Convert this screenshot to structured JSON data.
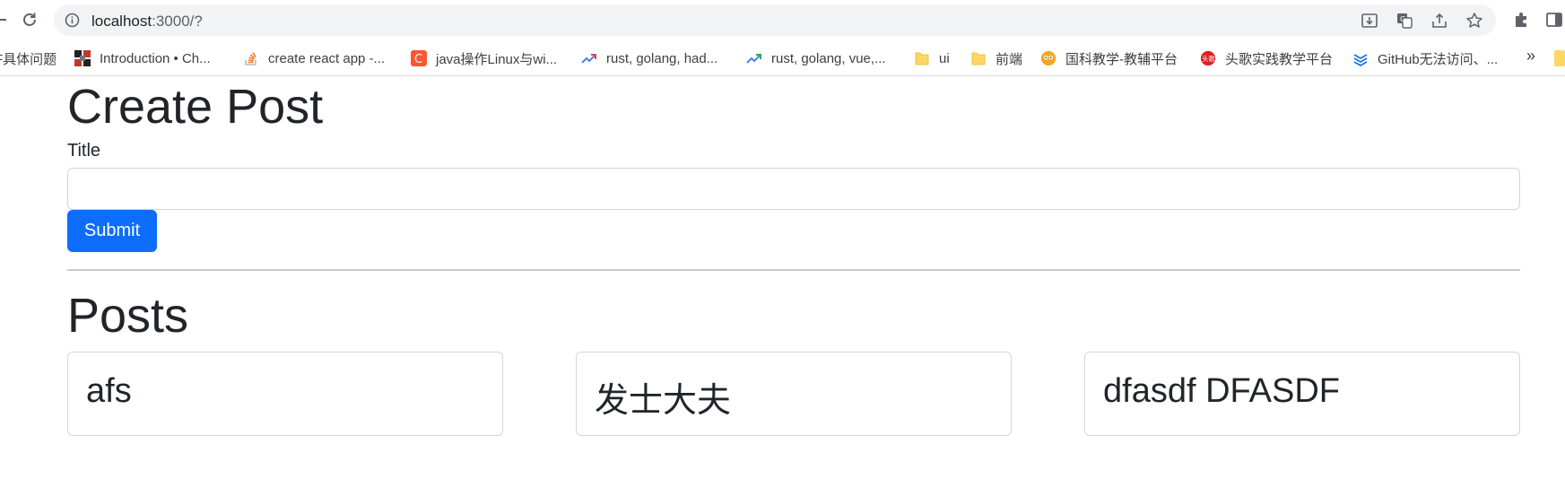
{
  "browser": {
    "url_host": "localhost",
    "url_path": ":3000/?",
    "bookmarks": [
      {
        "label": "F具体问题",
        "icon": "none"
      },
      {
        "label": "Introduction • Ch...",
        "icon": "grid-favicon-icon"
      },
      {
        "label": "create react app -...",
        "icon": "stackoverflow-icon"
      },
      {
        "label": "java操作Linux与wi...",
        "icon": "csdn-icon"
      },
      {
        "label": "rust, golang, had...",
        "icon": "trend-icon"
      },
      {
        "label": "rust, golang, vue,...",
        "icon": "trend-icon"
      },
      {
        "label": "ui",
        "icon": "folder-icon"
      },
      {
        "label": "前端",
        "icon": "folder-icon"
      },
      {
        "label": "国科教学-教辅平台",
        "icon": "owl-icon"
      },
      {
        "label": "头歌实践教学平台",
        "icon": "touge-icon"
      },
      {
        "label": "GitHub无法访问、...",
        "icon": "layers-icon"
      }
    ],
    "more_label": "»",
    "colors": {
      "omnibox_bg": "#f1f3f4",
      "folder": "#fdd663"
    }
  },
  "page": {
    "heading": "Create Post",
    "form": {
      "title_label": "Title",
      "title_value": "",
      "submit_label": "Submit"
    },
    "posts_heading": "Posts",
    "posts": [
      {
        "title": "afs"
      },
      {
        "title": "发士大夫"
      },
      {
        "title": "dfasdf DFASDF"
      }
    ],
    "colors": {
      "primary": "#0d6efd",
      "text": "#212529"
    }
  }
}
